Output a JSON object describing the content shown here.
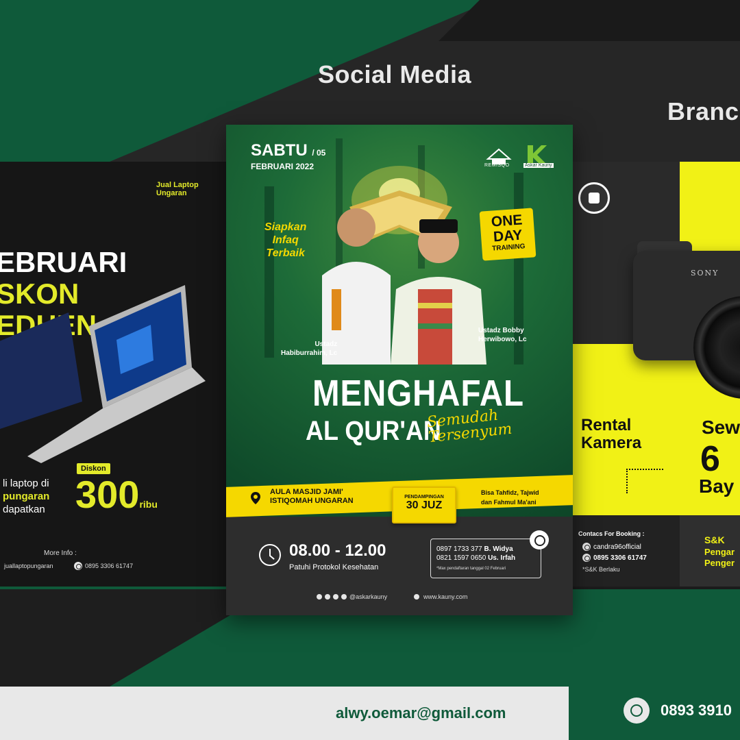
{
  "headings": {
    "social_media": "Social Media",
    "brand": "Branc"
  },
  "left_card": {
    "brand_line1": "Jual Laptop",
    "brand_line2": "Ungaran",
    "big_line1": "EBRUARI",
    "big_line2": "SKON",
    "big_line3": "EDHEN",
    "desc_line1": "li laptop di",
    "desc_line2": "pungaran",
    "desc_line3": "dapatkan",
    "diskon_label": "Diskon",
    "price_value": "300",
    "price_unit": "ribu",
    "more_info": "More Info :",
    "handle": "juallaptopungaran",
    "phone": "0895 3306 61747"
  },
  "poster": {
    "day": "SABTU",
    "day_num": "/ 05",
    "month_year": "FEBRUARI 2022",
    "logo1_text": "REMISQO",
    "logo2_text": "Askar Kauny",
    "siapkan_line1": "Siapkan",
    "siapkan_line2": "Infaq",
    "siapkan_line3": "Terbaik",
    "oneday_line1": "ONE",
    "oneday_line2": "DAY",
    "oneday_line3": "TRAINING",
    "speaker1_line1": "Ustadz",
    "speaker1_line2": "Habiburrahim, Lc",
    "speaker2_line1": "Ustadz Bobby",
    "speaker2_line2": "Herwibowo, Lc",
    "title_line1": "MENGHAFAL",
    "title_line2": "AL QUR'AN",
    "script_line1": "Semudah",
    "script_line2": "Tersenyum",
    "location_line1": "AULA MASJID JAMI'",
    "location_line2": "ISTIQOMAH UNGARAN",
    "pendampingan_label": "PENDAMPINGAN",
    "pendampingan_value": "30 JUZ",
    "tahfidz_line1": "Bisa Tahfidz, Tajwid",
    "tahfidz_line2": "dan Fahmul Ma'ani",
    "time": "08.00 - 12.00",
    "protokol": "Patuhi Protokol Kesehatan",
    "contact1_num": "0897 1733 377",
    "contact1_name": "B. Widya",
    "contact2_num": "0821 1597 0650",
    "contact2_name": "Us. Irfah",
    "contact_note": "*Max pendaftaran tanggal 02 Februari",
    "social_handle": "@askarkauny",
    "website": "www.kauny.com"
  },
  "right_card": {
    "camera_brand": "SONY",
    "rental_line1": "Rental",
    "rental_line2": "Kamera",
    "sew": "Sew",
    "six": "6",
    "bay": "Bay",
    "contacs": "Contacs For Booking :",
    "ig": "candra96official",
    "phone": "0895 3306 61747",
    "snk": "*S&K Berlaku",
    "sk": "S&K",
    "peng_line1": "Pengar",
    "peng_line2": "Penger"
  },
  "footer": {
    "email": "alwy.oemar@gmail.com",
    "phone": "0893 3910"
  },
  "colors": {
    "green": "#0f5a3a",
    "yellow": "#f5d800",
    "lime": "#e3ea2a",
    "dark": "#161616"
  }
}
